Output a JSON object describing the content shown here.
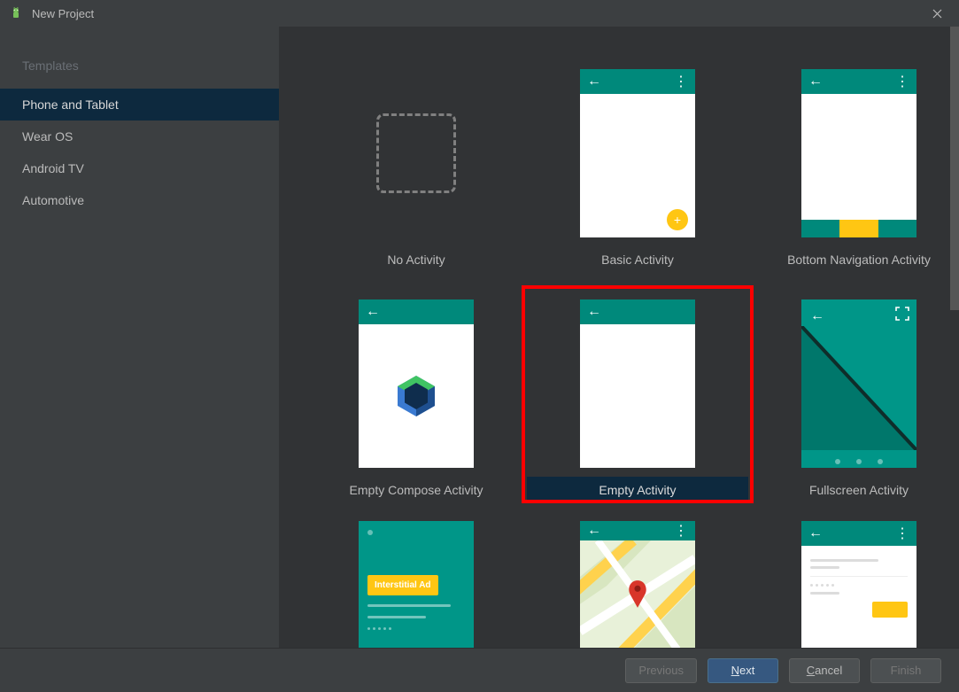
{
  "window": {
    "title": "New Project"
  },
  "sidebar": {
    "heading": "Templates",
    "items": [
      {
        "label": "Phone and Tablet",
        "selected": true
      },
      {
        "label": "Wear OS",
        "selected": false
      },
      {
        "label": "Android TV",
        "selected": false
      },
      {
        "label": "Automotive",
        "selected": false
      }
    ]
  },
  "templates": [
    {
      "label": "No Activity",
      "kind": "no-activity",
      "selected": false
    },
    {
      "label": "Basic Activity",
      "kind": "basic",
      "selected": false
    },
    {
      "label": "Bottom Navigation Activity",
      "kind": "bottom-nav",
      "selected": false
    },
    {
      "label": "Empty Compose Activity",
      "kind": "compose",
      "selected": false
    },
    {
      "label": "Empty Activity",
      "kind": "empty",
      "selected": true,
      "highlighted": true
    },
    {
      "label": "Fullscreen Activity",
      "kind": "fullscreen",
      "selected": false
    },
    {
      "label": "",
      "kind": "interstitial",
      "interstitial_label": "Interstitial Ad",
      "selected": false
    },
    {
      "label": "",
      "kind": "map",
      "selected": false
    },
    {
      "label": "",
      "kind": "scroll",
      "selected": false
    }
  ],
  "footer": {
    "previous": "Previous",
    "next": "Next",
    "cancel": "Cancel",
    "finish": "Finish"
  },
  "colors": {
    "accent": "#00897b",
    "highlight": "#ff0000",
    "primary_btn": "#365880",
    "sidebar_selected": "#0d293e",
    "fab": "#ffc613"
  }
}
